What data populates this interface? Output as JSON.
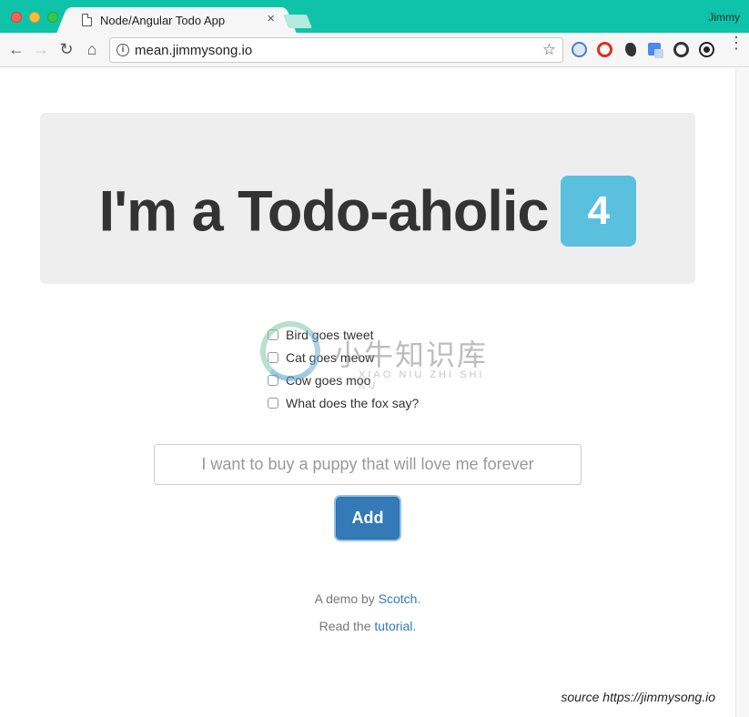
{
  "browser": {
    "tab_title": "Node/Angular Todo App",
    "tab_close": "×",
    "profile_name": "Jimmy",
    "url": "mean.jimmysong.io",
    "icons": {
      "back": "←",
      "forward": "→",
      "reload": "↻",
      "home": "⌂",
      "info": "i",
      "star": "☆",
      "menu": "⋮"
    }
  },
  "jumbotron": {
    "heading": "I'm a Todo-aholic",
    "count": "4",
    "badge_color": "#5bc0de"
  },
  "todos": [
    {
      "text": "Bird goes tweet",
      "checked": false
    },
    {
      "text": "Cat goes meow",
      "checked": false
    },
    {
      "text": "Cow goes moo",
      "checked": false
    },
    {
      "text": "What does the fox say?",
      "checked": false
    }
  ],
  "form": {
    "input_placeholder": "I want to buy a puppy that will love me forever",
    "input_value": "",
    "add_label": "Add",
    "primary_color": "#337ab7"
  },
  "footer": {
    "demo_prefix": "A demo by ",
    "demo_link": "Scotch",
    "demo_suffix": ".",
    "read_prefix": "Read the ",
    "read_link": "tutorial",
    "read_suffix": "."
  },
  "watermark": {
    "chinese": "小牛知识库",
    "latin": "XIAO NIU ZHI SHI KU"
  },
  "source_note": "source https://jimmysong.io"
}
